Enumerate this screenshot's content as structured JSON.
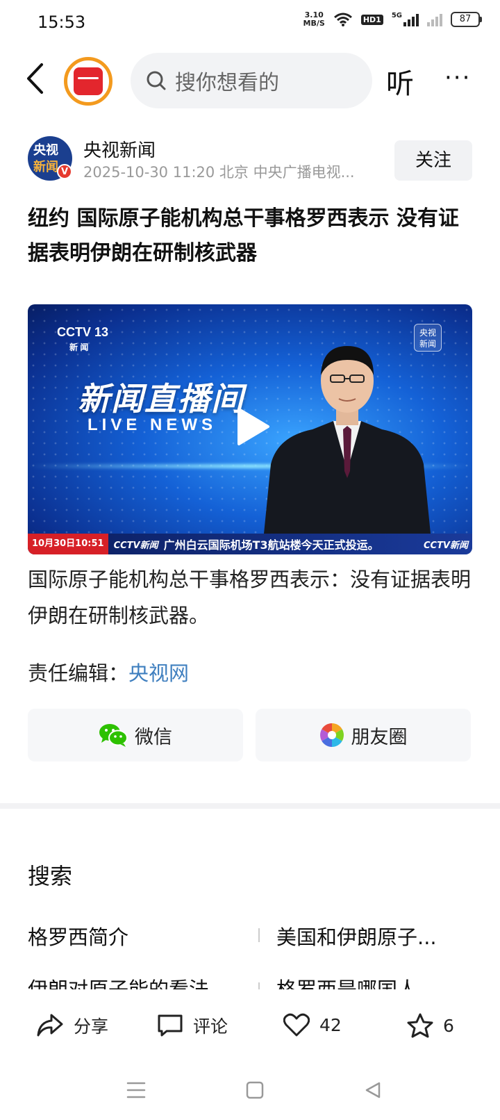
{
  "status_bar": {
    "time": "15:53",
    "net_speed_value": "3.10",
    "net_speed_unit": "MB/S",
    "hd_label": "HD1",
    "network_label": "5G",
    "battery": "87"
  },
  "nav": {
    "search_placeholder": "搜你想看的",
    "listen_label": "听",
    "more_label": "···"
  },
  "author": {
    "avatar_line1": "央视",
    "avatar_line2": "新闻",
    "verified_mark": "V",
    "name": "央视新闻",
    "meta": "2025-10-30  11:20  北京  中央广播电视...",
    "follow_label": "关注"
  },
  "article": {
    "headline": "纽约 国际原子能机构总干事格罗西表示 没有证据表明伊朗在研制核武器",
    "video": {
      "channel_logo": "CCTV 13",
      "channel_sub": "新 闻",
      "corner_logo": "央视 新闻",
      "show_title": "新闻直播间",
      "show_subtitle": "LIVE NEWS",
      "ticker_time": "10月30日10:51",
      "ticker_channel": "CCTV新闻",
      "ticker_text": "广州白云国际机场T3航站楼今天正式投运。",
      "ticker_channel_right": "CCTV新闻"
    },
    "body": "国际原子能机构总干事格罗西表示：没有证据表明伊朗在研制核武器。",
    "editor_label": "责任编辑：",
    "editor_name": "央视网"
  },
  "share": {
    "wechat_label": "微信",
    "moments_label": "朋友圈"
  },
  "search_section": {
    "title": "搜索",
    "suggestions": [
      "格罗西简介",
      "美国和伊朗原子...",
      "伊朗对原子能的看法",
      "格罗西是哪国人"
    ]
  },
  "actions": {
    "share_label": "分享",
    "comment_label": "评论",
    "like_count": "42",
    "favorite_count": "6"
  },
  "colors": {
    "accent_orange": "#f39a1e",
    "brand_red": "#e3262d",
    "link_blue": "#3f7fbf"
  }
}
